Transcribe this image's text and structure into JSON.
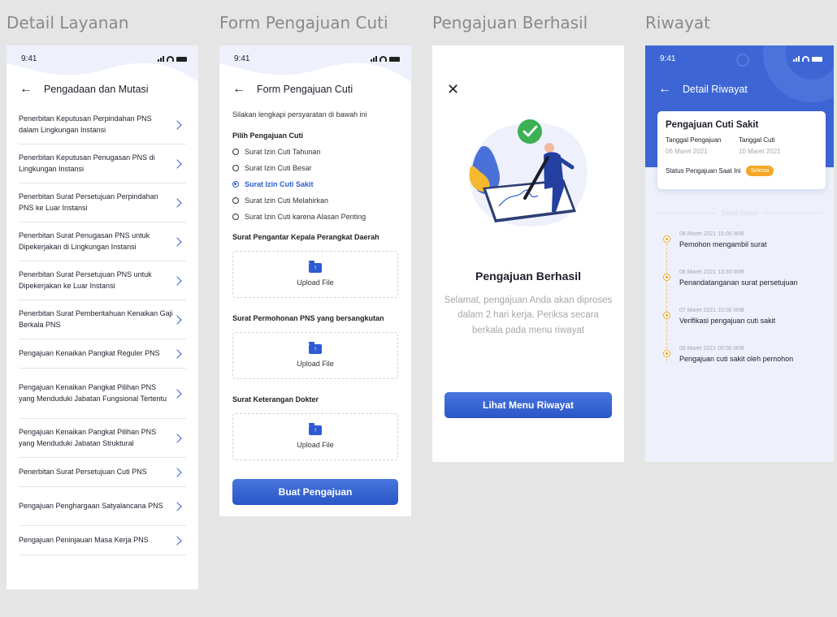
{
  "frames": {
    "detail_layanan": "Detail Layanan",
    "form_cuti": "Form Pengajuan Cuti",
    "berhasil": "Pengajuan Berhasil",
    "riwayat": "Riwayat"
  },
  "status_time": "9:41",
  "detail": {
    "nav_title": "Pengadaan dan Mutasi",
    "items": [
      "Penerbitan Keputusan Perpindahan PNS dalam Lingkungan Instansi",
      "Penerbitan Keputusan Penugasan PNS di Lingkungan Instansi",
      "Penerbitan Surat Persetujuan Perpindahan PNS ke Luar Instansi",
      "Penerbitan Surat Penugasan PNS untuk Dipekerjakan di Lingkungan Instansi",
      "Penerbitan Surat Persetujuan PNS untuk Dipekerjakan ke Luar Instansi",
      "Penerbitan Surat Pemberitahuan Kenaikan Gaji Berkala PNS",
      "Pengajuan Kenaikan Pangkat Reguler PNS",
      "Pengajuan Kenaikan Pangkat Pilihan PNS yang Menduduki Jabatan Fungsional Tertentu",
      "Pengajuan Kenaikan Pangkat Pilihan PNS yang Menduduki Jabatan Struktural",
      "Penerbitan Surat Persetujuan Cuti PNS",
      "Pengajuan Penghargaan Satyalancana PNS",
      "Pengajuan Peninjauan Masa Kerja PNS"
    ]
  },
  "form": {
    "nav_title": "Form Pengajuan Cuti",
    "intro": "Silakan lengkapi persyaratan di bawah ini",
    "choose_label": "Pilih Pengajuan Cuti",
    "options": [
      "Surat Izin Cuti Tahunan",
      "Surat Izin Cuti Besar",
      "Surat Izin Cuti Sakit",
      "Surat Izin Cuti Melahirkan",
      "Surat Izin Cuti karena Alasan Penting"
    ],
    "selected_index": 2,
    "uploads": [
      "Surat Pengantar Kepala Perangkat Daerah",
      "Surat Permohonan PNS yang bersangkutan",
      "Surat Keterangan Dokter"
    ],
    "upload_label": "Upload File",
    "submit": "Buat Pengajuan"
  },
  "success": {
    "title": "Pengajuan Berhasil",
    "desc": "Selamat, pengajuan Anda akan diproses dalam 2 hari kerja. Periksa secara berkala pada menu riwayat",
    "button": "Lihat Menu Riwayat"
  },
  "riwayat": {
    "nav_title": "Detail Riwayat",
    "card_title": "Pengajuan Cuti Sakit",
    "date_label": "Tanggal Pengajuan",
    "date_value": "06 Maret 2021",
    "leave_label": "Tanggal Cuti",
    "leave_value": "10 Maret 2021",
    "status_label": "Status Pengajuan Saat Ini",
    "status_value": "Selesai",
    "timeline_label": "Detail Status",
    "timeline": [
      {
        "time": "08 Maret 2021 15:00 WIB",
        "text": "Pemohon mengambil surat"
      },
      {
        "time": "08 Maret 2021 13:30 WIB",
        "text": "Penandatanganan surat persetujuan"
      },
      {
        "time": "07 Maret 2021 10:00 WIB",
        "text": "Verifikasi pengajuan cuti sakit"
      },
      {
        "time": "06 Maret 2021 09:00 WIB",
        "text": "Pengajuan cuti sakit oleh pemohon"
      }
    ]
  },
  "colors": {
    "primary": "#2d5bd3",
    "accent": "#f5a623",
    "header": "#3d66d4"
  }
}
